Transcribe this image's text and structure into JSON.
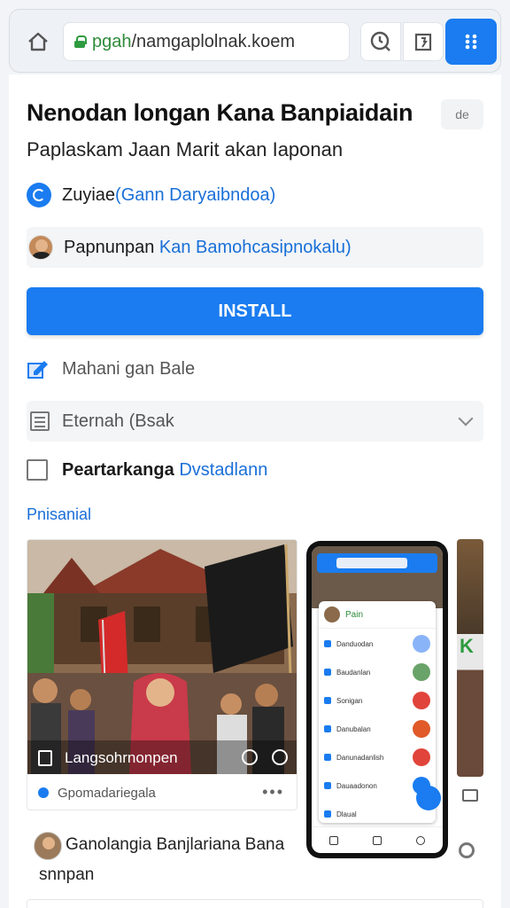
{
  "browser": {
    "url_domain": "pgah",
    "url_rest": "/namgaplolnak.koem"
  },
  "app": {
    "title": "Nenodan longan Kana Banpiaidain",
    "subtitle": "Paplaskam Jaan Marit akan Iaponan",
    "title_tag": "de",
    "developer_name": "Zuyiae",
    "developer_link": "(Gann Daryaibndoa)",
    "publisher_name": "Papnunpan",
    "publisher_link": "Kan Bamohcasipnokalu)",
    "install_label": "INSTALL"
  },
  "options": {
    "review_label": "Mahani gan Bale",
    "select_label": "Eternah (Bsak",
    "checkbox_label": "Peartarkanga",
    "checkbox_link": "Dvstadlann"
  },
  "gallery": {
    "section_label": "Pnisanial",
    "photo_caption": "Langsohrnonpen",
    "footer_text": "Gpomadariegala",
    "more": "•••",
    "phone": {
      "header": "Pain",
      "items": [
        {
          "label": "Danduodan",
          "btn_color": "#8ab4f8"
        },
        {
          "label": "Baudanlan",
          "btn_color": "#6aa36a"
        },
        {
          "label": "Sonigan",
          "btn_color": "#e0443a"
        },
        {
          "label": "Danubalan",
          "btn_color": "#e05a2a"
        },
        {
          "label": "Danunadanlish",
          "btn_color": "#e0443a"
        },
        {
          "label": "Dauaadonon",
          "btn_color": "#1a7cf0"
        },
        {
          "label": "Dlaual",
          "btn_color": "#ffffff"
        }
      ]
    },
    "right_letter": "K"
  },
  "comment": {
    "line1": "Ganolangia Banjlariana Bana",
    "line2": "snnpan"
  },
  "colors": {
    "accent": "#1a7cf0",
    "link": "#1a6fd8",
    "secure": "#2e8b3a"
  }
}
